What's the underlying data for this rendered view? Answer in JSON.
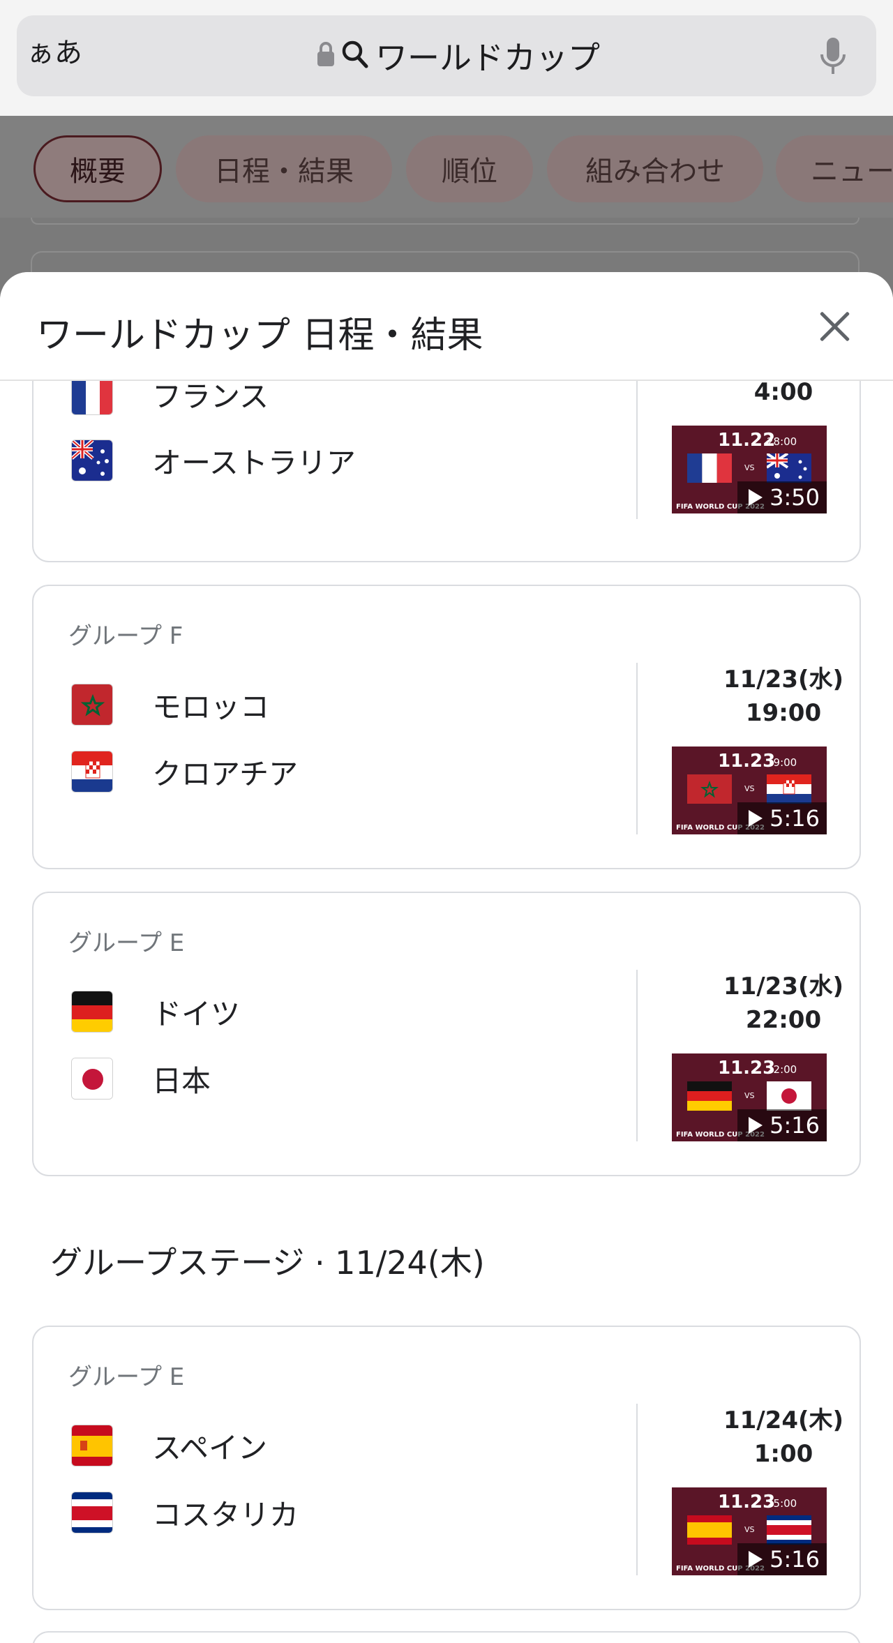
{
  "browser": {
    "aa_label": "ぁあ",
    "url_text": "ワールドカップ"
  },
  "chips": [
    {
      "label": "概要",
      "active": true
    },
    {
      "label": "日程・結果",
      "active": false
    },
    {
      "label": "順位",
      "active": false
    },
    {
      "label": "組み合わせ",
      "active": false
    },
    {
      "label": "ニュー",
      "active": false
    }
  ],
  "sheet": {
    "title": "ワールドカップ 日程・結果"
  },
  "matches": [
    {
      "group": "",
      "team1": "フランス",
      "team2": "オーストラリア",
      "date": "",
      "time": "4:00",
      "thumb_date": "11.22",
      "thumb_time": "28:00",
      "thumb_caption": "FIFA WORLD CUP 2022",
      "duration": "3:50"
    },
    {
      "group": "グループ F",
      "team1": "モロッコ",
      "team2": "クロアチア",
      "date": "11/23(水)",
      "time": "19:00",
      "thumb_date": "11.23",
      "thumb_time": "19:00",
      "thumb_caption": "FIFA WORLD CUP 2022",
      "duration": "5:16"
    },
    {
      "group": "グループ E",
      "team1": "ドイツ",
      "team2": "日本",
      "date": "11/23(水)",
      "time": "22:00",
      "thumb_date": "11.23",
      "thumb_time": "22:00",
      "thumb_caption": "FIFA WORLD CUP 2022",
      "duration": "5:16"
    },
    {
      "group": "グループ E",
      "team1": "スペイン",
      "team2": "コスタリカ",
      "date": "11/24(木)",
      "time": "1:00",
      "thumb_date": "11.23",
      "thumb_time": "25:00",
      "thumb_caption": "FIFA WORLD CUP 2022",
      "duration": "5:16"
    }
  ],
  "section": {
    "title": "グループステージ · 11/24(木)"
  },
  "icons": {
    "lock": "lock-icon",
    "search": "search-icon",
    "mic": "microphone-icon",
    "close": "close-icon",
    "play": "play-icon"
  },
  "colors": {
    "chip_active_border": "#4a1a1f",
    "thumb_bg": "#5a1527"
  }
}
